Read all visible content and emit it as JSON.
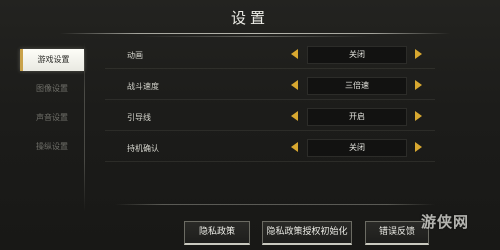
{
  "header": {
    "title": "设置"
  },
  "sidebar": {
    "items": [
      {
        "label": "游戏设置",
        "active": true
      },
      {
        "label": "图像设置",
        "active": false
      },
      {
        "label": "声音设置",
        "active": false
      },
      {
        "label": "操纵设置",
        "active": false
      }
    ]
  },
  "settings": [
    {
      "label": "动画",
      "value": "关闭"
    },
    {
      "label": "战斗速度",
      "value": "三倍速"
    },
    {
      "label": "引导线",
      "value": "开启"
    },
    {
      "label": "持机确认",
      "value": "关闭"
    }
  ],
  "footer": {
    "privacy_label": "隐私政策",
    "revoke_label": "隐私政策授权初始化",
    "report_label": "错误反馈",
    "watermark": "游侠网"
  },
  "colors": {
    "accent": "#d8a830",
    "background": "#1c1c1a",
    "active_tab": "#fdfdf8"
  }
}
